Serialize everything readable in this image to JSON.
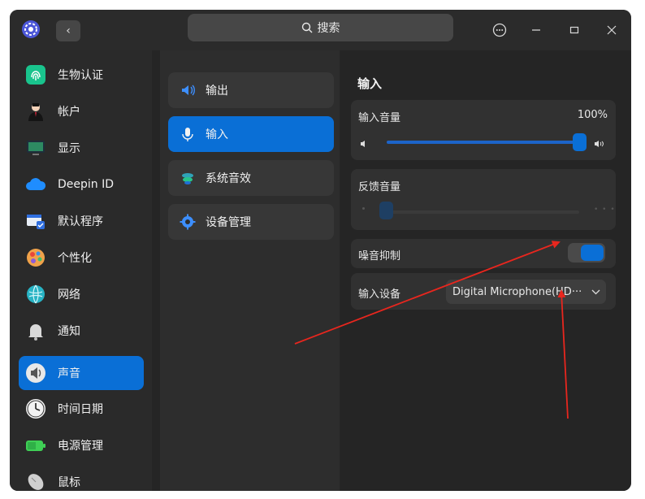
{
  "header": {
    "search_placeholder": "搜索"
  },
  "sidebar": {
    "items": [
      {
        "label": "生物认证",
        "icon": "fingerprint-icon"
      },
      {
        "label": "帐户",
        "icon": "account-icon"
      },
      {
        "label": "显示",
        "icon": "display-icon"
      },
      {
        "label": "Deepin ID",
        "icon": "cloud-icon"
      },
      {
        "label": "默认程序",
        "icon": "default-apps-icon"
      },
      {
        "label": "个性化",
        "icon": "personalization-icon"
      },
      {
        "label": "网络",
        "icon": "network-icon"
      },
      {
        "label": "通知",
        "icon": "bell-icon"
      },
      {
        "label": "声音",
        "icon": "speaker-icon"
      },
      {
        "label": "时间日期",
        "icon": "clock-icon"
      },
      {
        "label": "电源管理",
        "icon": "battery-icon"
      },
      {
        "label": "鼠标",
        "icon": "mouse-icon"
      }
    ],
    "active": "声音"
  },
  "sound_menu": {
    "items": [
      {
        "label": "输出",
        "icon": "speaker-output-icon"
      },
      {
        "label": "输入",
        "icon": "microphone-icon"
      },
      {
        "label": "系统音效",
        "icon": "system-sound-icon"
      },
      {
        "label": "设备管理",
        "icon": "gear-icon"
      }
    ],
    "active": "输入"
  },
  "input_panel": {
    "title": "输入",
    "input_volume": {
      "label": "输入音量",
      "value_text": "100%",
      "value": 1.0
    },
    "feedback_volume": {
      "label": "反馈音量",
      "value": 0.0
    },
    "noise_suppression": {
      "label": "噪音抑制",
      "enabled": true
    },
    "input_device": {
      "label": "输入设备",
      "selected": "Digital Microphone(HD···"
    }
  },
  "colors": {
    "accent": "#0a6fd6",
    "annotation_arrow": "#e8261e"
  }
}
